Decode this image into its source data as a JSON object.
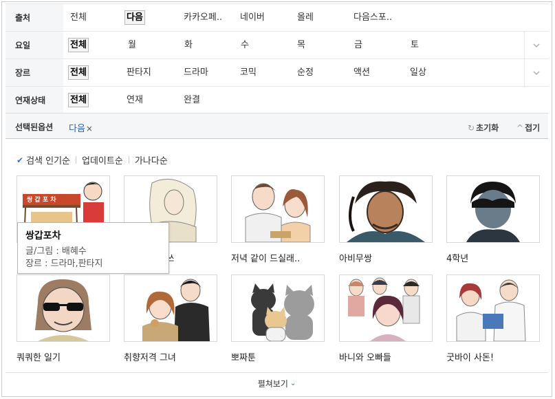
{
  "filters": {
    "source": {
      "label": "출처",
      "options": [
        "전체",
        "다음",
        "카카오페..",
        "네이버",
        "올레",
        "다음스포.."
      ]
    },
    "day": {
      "label": "요일",
      "options": [
        "전체",
        "월",
        "화",
        "수",
        "목",
        "금",
        "토"
      ]
    },
    "genre": {
      "label": "장르",
      "options": [
        "전체",
        "판타지",
        "드라마",
        "코믹",
        "순정",
        "액션",
        "일상"
      ]
    },
    "status": {
      "label": "연재상태",
      "options": [
        "전체",
        "연재",
        "완결"
      ]
    }
  },
  "selected_bar": {
    "label": "선택된옵션",
    "chip": "다음",
    "chip_remove": "×",
    "reset": "초기화",
    "reset_icon": "↻",
    "fold": "접기",
    "fold_icon": "^"
  },
  "sort": {
    "check": "✔",
    "options": [
      "검색 인기순",
      "업데이트순",
      "가나다순"
    ]
  },
  "items": [
    {
      "title": ""
    },
    {
      "title": "...쓰"
    },
    {
      "title": "저녁 같이 드실래.."
    },
    {
      "title": "아비무쌍"
    },
    {
      "title": "4학년"
    },
    {
      "title": "쿼쿼한 일기"
    },
    {
      "title": "취향저격 그녀"
    },
    {
      "title": "뽀짜툰"
    },
    {
      "title": "바니와 오빠들"
    },
    {
      "title": "굿바이 사돈!"
    }
  ],
  "thumb1_sign": "쌍 갑 포 차",
  "tooltip": {
    "title": "쌍갑포차",
    "line1": "글/그림 : 배혜수",
    "line2": "장르 : 드라마,판타지"
  },
  "more": {
    "label": "펼쳐보기",
    "icon": "⌄"
  },
  "colors": {
    "accent": "#2b5fb3",
    "check": "#3a6fd1"
  }
}
